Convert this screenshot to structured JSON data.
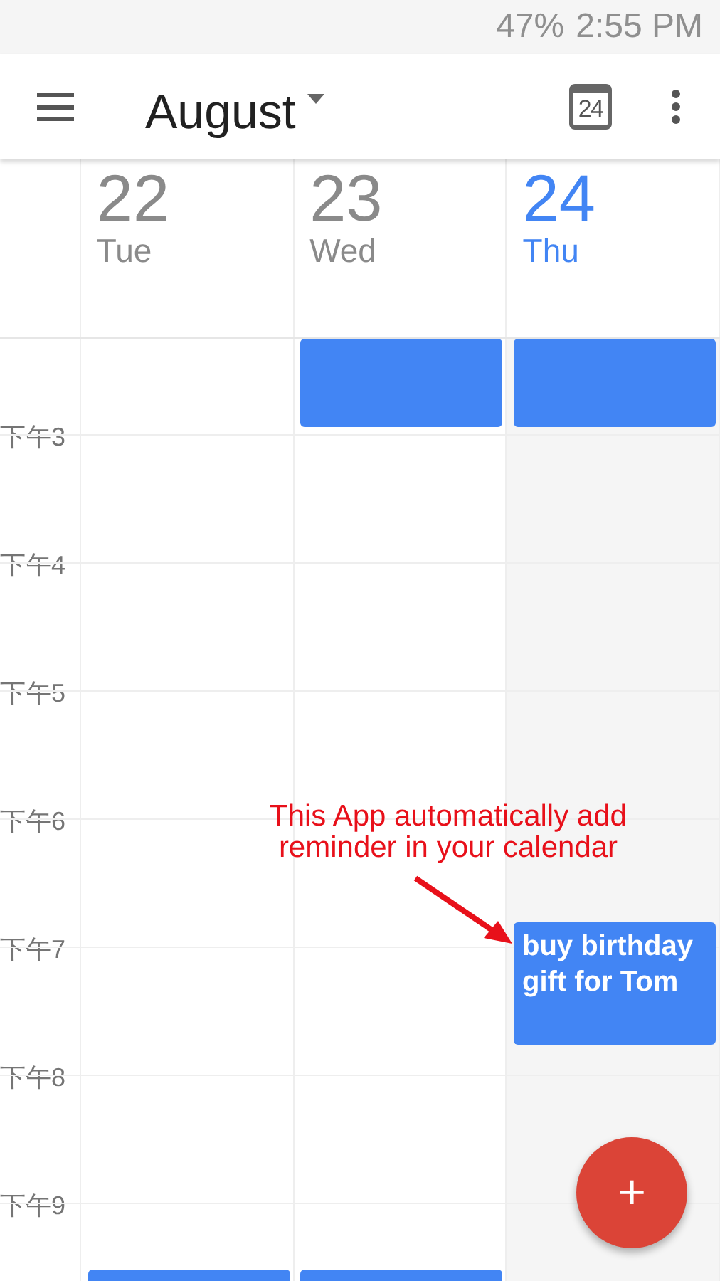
{
  "status_bar": {
    "battery": "47%",
    "time": "2:55 PM"
  },
  "toolbar": {
    "month": "August",
    "today_day": "24"
  },
  "days": [
    {
      "number": "22",
      "weekday": "Tue",
      "selected": false
    },
    {
      "number": "23",
      "weekday": "Wed",
      "selected": false
    },
    {
      "number": "24",
      "weekday": "Thu",
      "selected": true
    }
  ],
  "hours": [
    "下午3",
    "下午4",
    "下午5",
    "下午6",
    "下午7",
    "下午8",
    "下午9"
  ],
  "events": [
    {
      "title": "buy birthday gift for Tom"
    }
  ],
  "annotation": {
    "lines": [
      "This App automatically add",
      "reminder in your calendar"
    ]
  },
  "fab": {
    "label": "+"
  }
}
